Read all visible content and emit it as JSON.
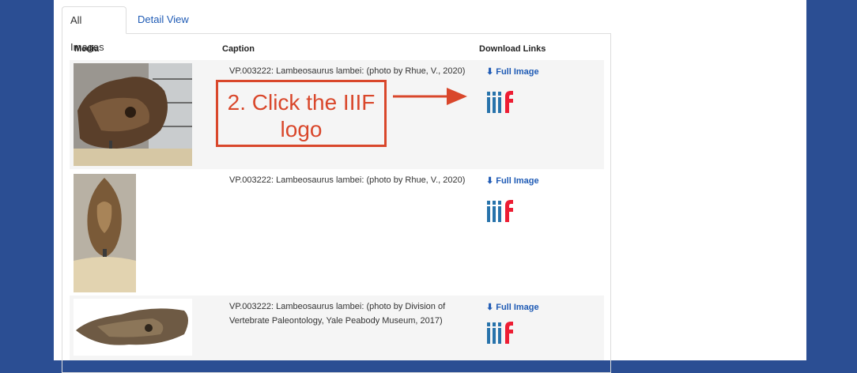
{
  "tabs": [
    {
      "label": "All Images",
      "active": true
    },
    {
      "label": "Detail View",
      "active": false
    }
  ],
  "table": {
    "headers": [
      "Media",
      "Caption",
      "Download Links"
    ],
    "rows": [
      {
        "caption": "VP.003222: Lambeosaurus lambei: (photo by Rhue, V., 2020)",
        "download_label": "Full Image",
        "iiif_icon": "iiif-logo-icon"
      },
      {
        "caption": "VP.003222: Lambeosaurus lambei: (photo by Rhue, V., 2020)",
        "download_label": "Full Image",
        "iiif_icon": "iiif-logo-icon"
      },
      {
        "caption_line1": "VP.003222: Lambeosaurus lambei: (photo by Division of",
        "caption_line2": "Vertebrate Paleontology, Yale Peabody Museum, 2017)",
        "download_label": "Full Image",
        "iiif_icon": "iiif-logo-icon"
      }
    ]
  },
  "annotation": {
    "line1": "2. Click the IIIF",
    "line2": "logo",
    "color": "#d9472b"
  },
  "colors": {
    "background": "#2b4e93",
    "link": "#1f5bb5",
    "iiif_blue": "#2873ab",
    "iiif_red": "#ed1d33"
  }
}
